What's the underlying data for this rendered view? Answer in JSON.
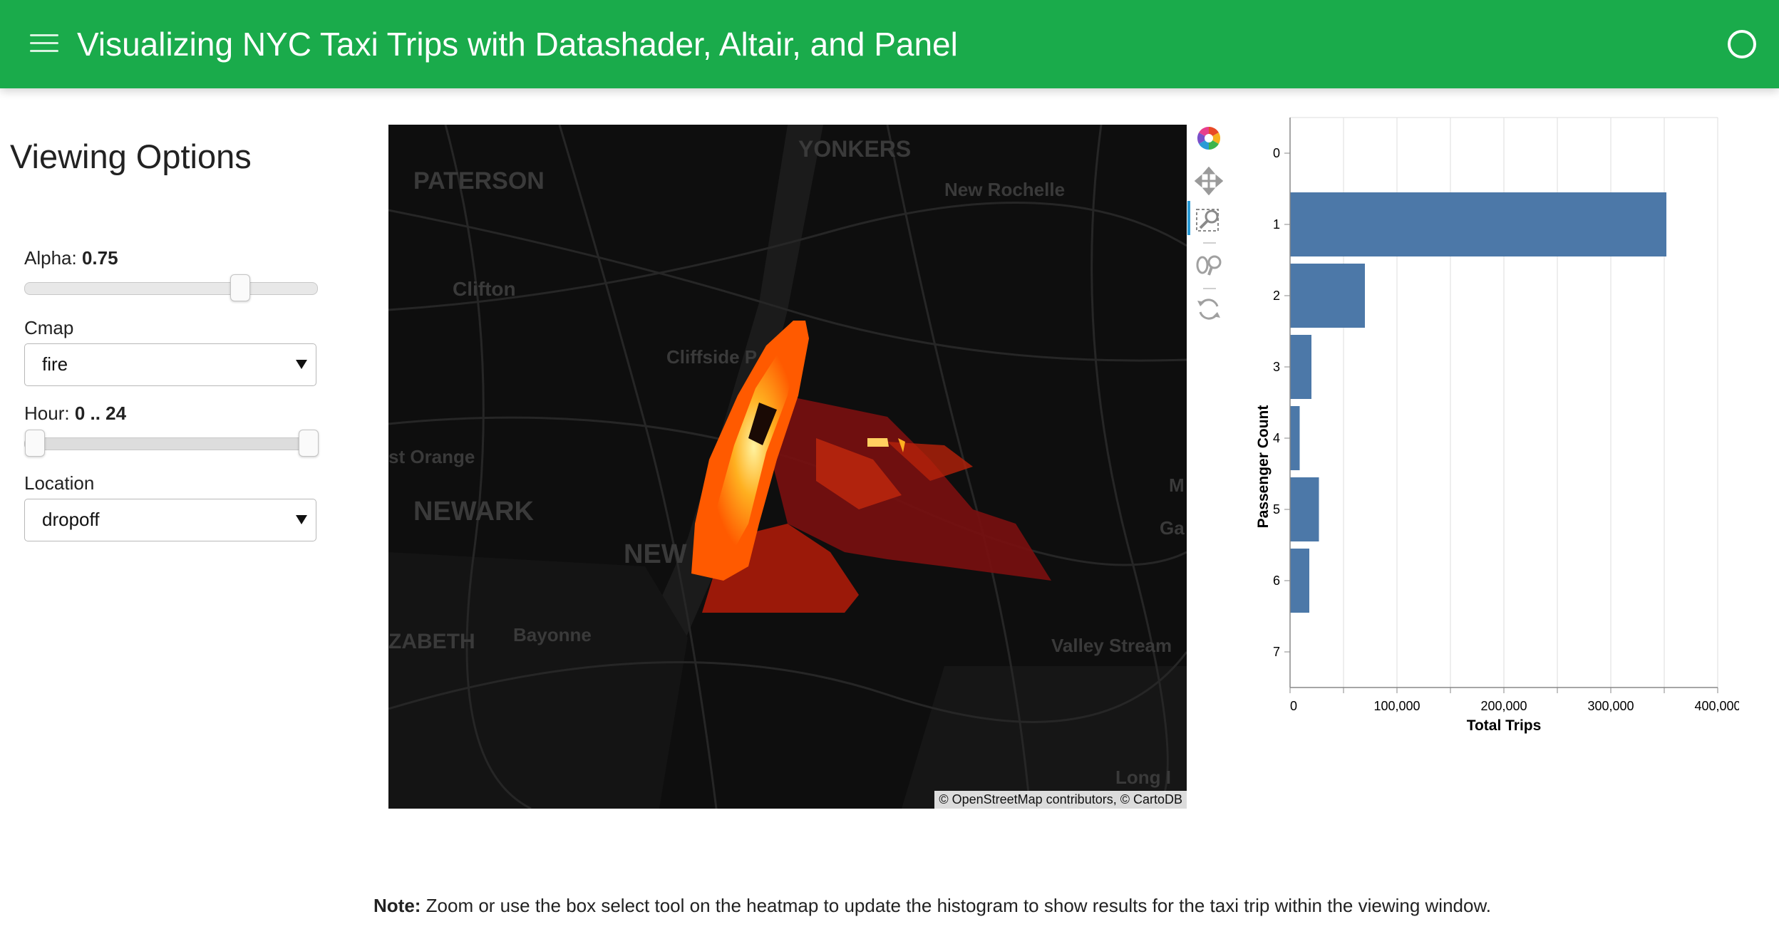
{
  "header": {
    "title": "Visualizing NYC Taxi Trips with Datashader, Altair, and Panel",
    "menu_icon": "hamburger-menu-icon",
    "status_icon": "idle-status-circle-icon"
  },
  "sidebar": {
    "title": "Viewing Options",
    "alpha": {
      "label": "Alpha:",
      "value": "0.75",
      "fraction": 0.75
    },
    "cmap": {
      "label": "Cmap",
      "selected": "fire"
    },
    "hour": {
      "label": "Hour:",
      "value": "0 .. 24",
      "start": 0,
      "end": 24,
      "min": 0,
      "max": 24
    },
    "location": {
      "label": "Location",
      "selected": "dropoff"
    }
  },
  "map": {
    "attribution": "© OpenStreetMap contributors, © CartoDB",
    "place_labels": [
      "PATERSON",
      "YONKERS",
      "New Rochelle",
      "Clifton",
      "Cliffside P",
      "st Orange",
      "NEWARK",
      "NEW",
      "ZABETH",
      "Bayonne",
      "Valley Stream",
      "Long I",
      "M",
      "Ga"
    ]
  },
  "toolbar": {
    "tools": [
      {
        "name": "bokeh-logo-icon"
      },
      {
        "name": "pan-tool-icon"
      },
      {
        "name": "box-select-tool-icon",
        "active": true
      },
      {
        "name": "wheel-zoom-tool-icon"
      },
      {
        "name": "reset-tool-icon"
      }
    ]
  },
  "chart_data": {
    "type": "bar",
    "orientation": "horizontal",
    "categories": [
      "0",
      "1",
      "2",
      "3",
      "4",
      "5",
      "6",
      "7"
    ],
    "values": [
      0,
      352000,
      70000,
      20000,
      9000,
      27000,
      18000,
      0
    ],
    "xlabel": "Total Trips",
    "ylabel": "Passenger Count",
    "xlim": [
      0,
      400000
    ],
    "xticks": [
      "0",
      "100,000",
      "200,000",
      "300,000",
      "400,000"
    ],
    "bar_color": "#4c78a8",
    "grid": true
  },
  "note": {
    "bold": "Note:",
    "text": " Zoom or use the box select tool on the heatmap to update the histogram to show results for the taxi trip within the viewing window."
  }
}
